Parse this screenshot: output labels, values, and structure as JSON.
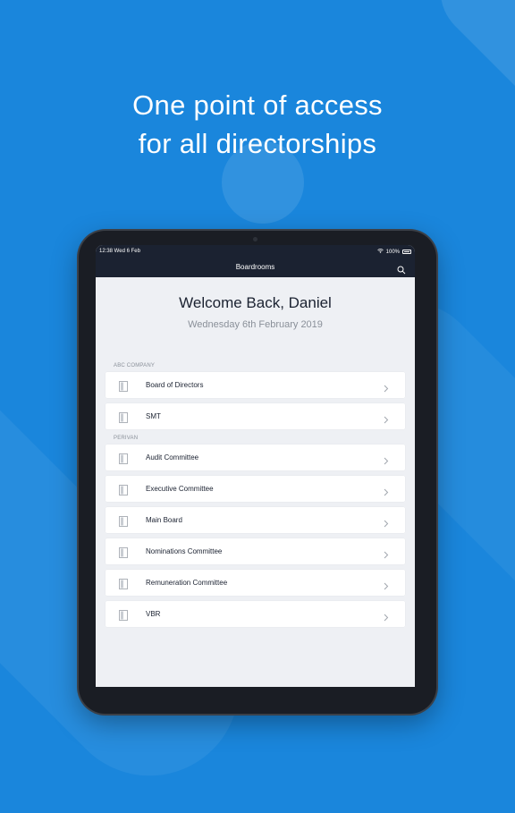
{
  "headline": {
    "line1": "One point of access",
    "line2": "for all directorships"
  },
  "status_bar": {
    "time_date": "12:38  Wed 6 Feb",
    "battery": "100%"
  },
  "nav": {
    "title": "Boardrooms"
  },
  "welcome": {
    "title": "Welcome Back, Daniel",
    "date": "Wednesday 6th February 2019"
  },
  "groups": [
    {
      "name": "ABC COMPANY",
      "items": [
        "Board of Directors",
        "SMT"
      ]
    },
    {
      "name": "PERIVAN",
      "items": [
        "Audit Committee",
        "Executive Committee",
        "Main Board",
        "Nominations Committee",
        "Remuneration Committee",
        "VBR"
      ]
    }
  ],
  "colors": {
    "background": "#1a86dc",
    "nav_bar": "#1b2231",
    "screen_bg": "#eef0f4"
  },
  "icons": {
    "row_icon": "door-icon",
    "row_chevron": "chevron-right-icon",
    "nav_action": "search-icon"
  }
}
